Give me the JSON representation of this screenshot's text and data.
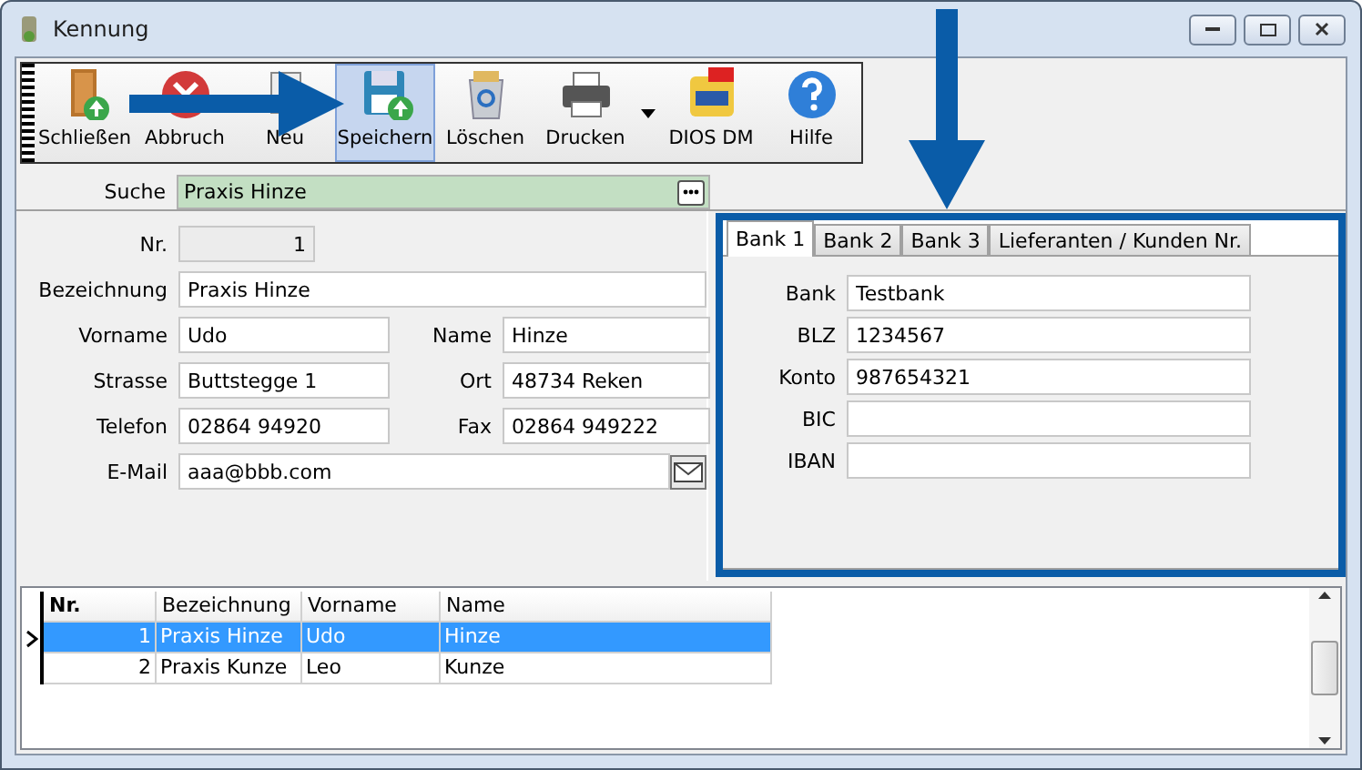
{
  "window": {
    "title": "Kennung"
  },
  "toolbar": [
    {
      "label": "Schließen",
      "selected": false
    },
    {
      "label": "Abbruch",
      "selected": false
    },
    {
      "label": "Neu",
      "selected": false
    },
    {
      "label": "Speichern",
      "selected": true
    },
    {
      "label": "Löschen",
      "selected": false
    },
    {
      "label": "Drucken",
      "selected": false,
      "dropdown": true
    },
    {
      "label": "DIOS DM",
      "selected": false
    },
    {
      "label": "Hilfe",
      "selected": false
    }
  ],
  "search": {
    "label": "Suche",
    "value": "Praxis Hinze"
  },
  "form": {
    "nr": {
      "label": "Nr.",
      "value": "1"
    },
    "bezeichnung": {
      "label": "Bezeichnung",
      "value": "Praxis Hinze"
    },
    "pairs": [
      [
        {
          "label": "Vorname",
          "value": "Udo"
        },
        {
          "label": "Name",
          "value": "Hinze"
        }
      ],
      [
        {
          "label": "Strasse",
          "value": "Buttstegge 1"
        },
        {
          "label": "Ort",
          "value": "48734 Reken"
        }
      ],
      [
        {
          "label": "Telefon",
          "value": "02864 94920"
        },
        {
          "label": "Fax",
          "value": "02864 949222"
        }
      ]
    ],
    "email": {
      "label": "E-Mail",
      "value": "aaa@bbb.com"
    }
  },
  "bank_tabs": [
    {
      "label": "Bank 1",
      "selected": true
    },
    {
      "label": "Bank 2",
      "selected": false
    },
    {
      "label": "Bank 3",
      "selected": false
    },
    {
      "label": "Lieferanten / Kunden Nr.",
      "selected": false
    }
  ],
  "bank_fields": [
    {
      "label": "Bank",
      "value": "Testbank"
    },
    {
      "label": "BLZ",
      "value": "1234567"
    },
    {
      "label": "Konto",
      "value": "987654321"
    },
    {
      "label": "BIC"
    },
    {
      "label": "IBAN"
    }
  ],
  "table": {
    "columns": [
      "Nr.",
      "Bezeichnung",
      "Vorname",
      "Name"
    ],
    "rows": [
      {
        "cells": [
          "1",
          "Praxis Hinze",
          "Udo",
          "Hinze"
        ],
        "selected": true
      },
      {
        "cells": [
          "2",
          "Praxis Kunze",
          "Leo",
          "Kunze"
        ],
        "selected": false
      }
    ]
  },
  "annotations": [
    {
      "kind": "arrow-right"
    },
    {
      "kind": "arrow-down"
    }
  ]
}
